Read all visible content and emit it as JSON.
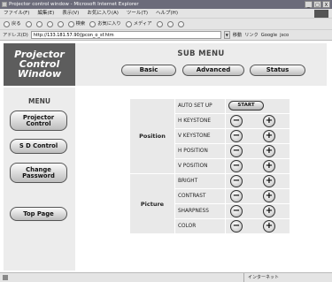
{
  "window": {
    "title": "Projector control window - Microsoft Internet Explorer",
    "controls": [
      "_",
      "□",
      "X"
    ]
  },
  "menubar": [
    "ファイル(F)",
    "編集(E)",
    "表示(V)",
    "お気に入り(A)",
    "ツール(T)",
    "ヘルプ(H)"
  ],
  "toolbar": {
    "back": "戻る",
    "search": "検索",
    "favorites": "お気に入り",
    "media": "メディア"
  },
  "addressbar": {
    "label": "アドレス(D)",
    "url": "http://133.181.57.90/jpcon_o_sf.htm",
    "go": "移動",
    "links": "リンク",
    "google": "Google",
    "jsco": "jsco"
  },
  "logo": [
    "Projector",
    "Control",
    "Window"
  ],
  "submenu": {
    "title": "SUB MENU",
    "buttons": [
      "Basic",
      "Advanced",
      "Status"
    ]
  },
  "menu": {
    "title": "MENU",
    "items": [
      {
        "line1": "Projector",
        "line2": "Control"
      },
      {
        "line1": "S D Control",
        "line2": ""
      },
      {
        "line1": "Change",
        "line2": "Password"
      },
      {
        "line1": "Top Page",
        "line2": ""
      }
    ]
  },
  "position_group": {
    "label": "Position",
    "rows": [
      "AUTO SET UP",
      "H KEYSTONE",
      "V KEYSTONE",
      "H POSITION",
      "V POSITION"
    ],
    "start_label": "START"
  },
  "picture_group": {
    "label": "Picture",
    "rows": [
      "BRIGHT",
      "CONTRAST",
      "SHARPNESS",
      "COLOR"
    ]
  },
  "symbols": {
    "minus": "−",
    "plus": "+"
  },
  "statusbar": {
    "zone": "インターネット"
  }
}
